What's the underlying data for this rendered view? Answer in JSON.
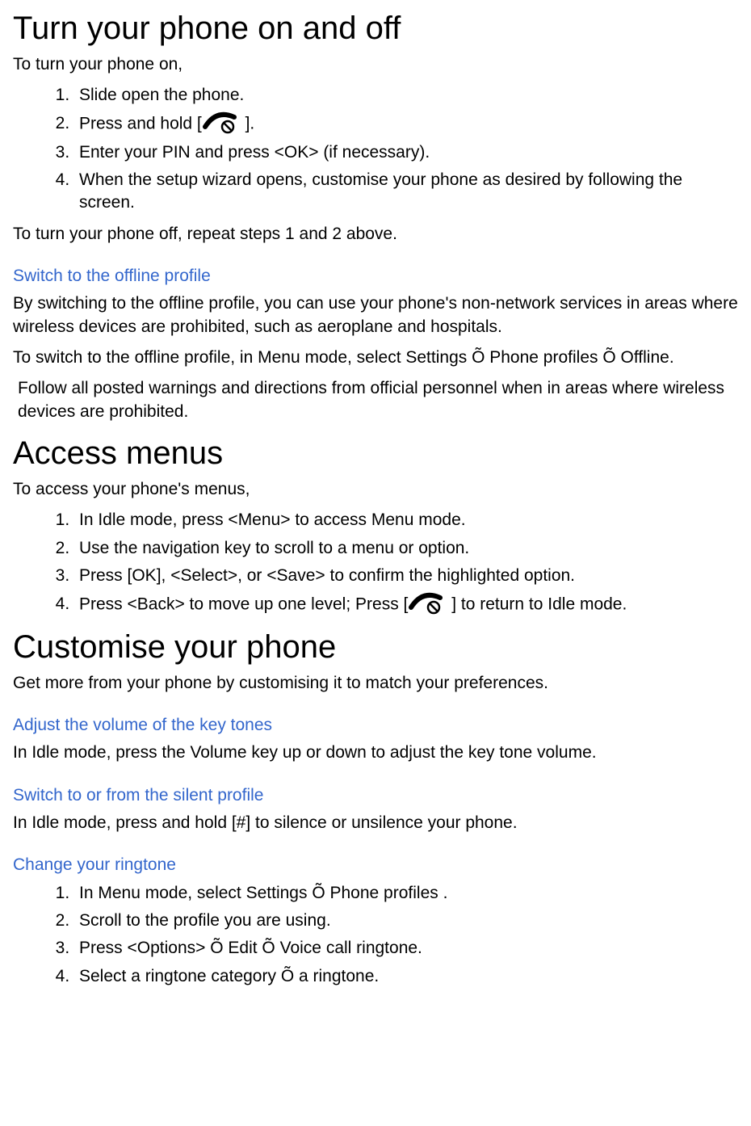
{
  "section1": {
    "heading": "Turn your phone on and off",
    "intro": "To turn your phone on,",
    "steps": {
      "s1": "Slide open the phone.",
      "s2a": "Press and hold [",
      "s2b": " ].",
      "s3": "Enter your PIN and press <OK> (if necessary).",
      "s4": "When the setup wizard opens, customise your phone as desired by following the screen."
    },
    "outro": "To turn your phone off, repeat steps 1 and 2 above."
  },
  "section2": {
    "heading": "Switch to the offline profile",
    "p1": "By switching to the offline profile, you can use your phone's non-network services in areas where wireless devices are prohibited, such as aeroplane and hospitals.",
    "p2": "To switch to the offline profile, in Menu mode, select Settings Õ Phone profiles Õ Offline.",
    "p3": "Follow all posted warnings and directions from official personnel when in areas where wireless devices are prohibited."
  },
  "section3": {
    "heading": "Access menus",
    "intro": "To access your phone's menus,",
    "steps": {
      "s1": "In Idle mode, press <Menu> to access Menu mode.",
      "s2": "Use the navigation key to scroll to a menu or option.",
      "s3": "Press [OK], <Select>, or <Save> to confirm the highlighted option.",
      "s4a": "Press <Back> to move up one level; Press [",
      "s4b": " ] to return to Idle mode."
    }
  },
  "section4": {
    "heading": "Customise your phone",
    "intro": "Get more from your phone by customising it to match your preferences."
  },
  "section5": {
    "heading": "Adjust the volume of the key tones",
    "p1": "In Idle mode, press the Volume key up or down to adjust the key tone volume."
  },
  "section6": {
    "heading": "Switch to or from the silent profile",
    "p1": "In Idle mode, press and hold [#] to silence or unsilence your phone."
  },
  "section7": {
    "heading": "Change your ringtone",
    "steps": {
      "s1": "In Menu mode, select Settings Õ Phone profiles .",
      "s2": "Scroll to the profile you are using.",
      "s3": "Press <Options> Õ Edit Õ Voice call ringtone.",
      "s4": "Select a ringtone category Õ a ringtone."
    }
  }
}
